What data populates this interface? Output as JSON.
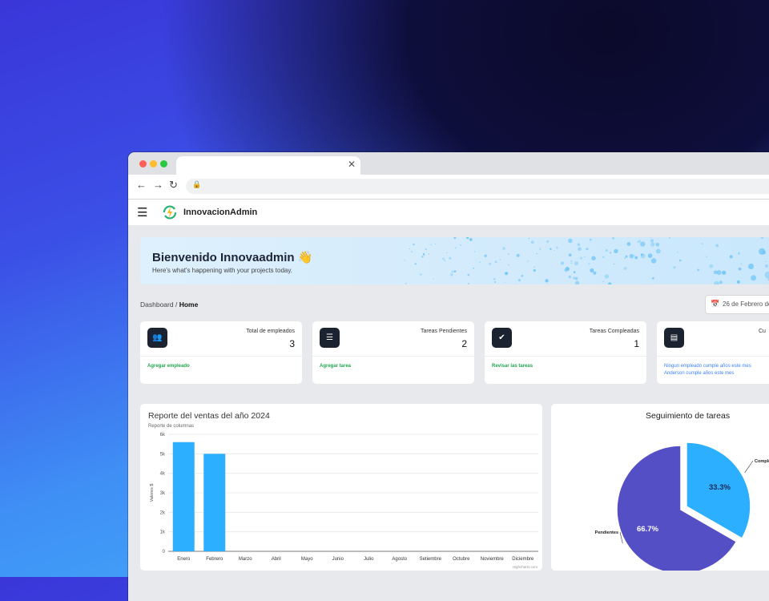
{
  "app": {
    "brand": "InnovacionAdmin"
  },
  "banner": {
    "title": "Bienvenido Innovaadmin 👋",
    "subtitle": "Here's what's happening with your projects today."
  },
  "breadcrumb": {
    "parent": "Dashboard",
    "separator": " / ",
    "current": "Home"
  },
  "date_filter": {
    "value": "26 de Febrero de"
  },
  "cards": [
    {
      "label": "Total de empleados",
      "value": "3",
      "link": "Agregar empleado",
      "icon": "users-icon"
    },
    {
      "label": "Tareas Pendientes",
      "value": "2",
      "link": "Agregar tarea",
      "icon": "list-icon"
    },
    {
      "label": "Tareas Compleadas",
      "value": "1",
      "link": "Revisar las tareas",
      "icon": "clipboard-check-icon"
    },
    {
      "label": "Cu",
      "value": "",
      "line1": "Ningun empleado cumple años este mes",
      "line2": "Anderson cumple años este mes",
      "icon": "cake-icon"
    }
  ],
  "sales_chart": {
    "title": "Reporte del ventas del año 2024",
    "subtitle": "Reporte de columnas",
    "credit": "Highcharts.com"
  },
  "tasks_chart": {
    "title": "Seguimiento de tareas"
  },
  "colors": {
    "bar": "#2caffe",
    "pie_completed": "#2caffe",
    "pie_pending": "#544fc5",
    "success": "#22a54e",
    "info": "#3b82f6"
  },
  "chart_data": [
    {
      "type": "bar",
      "title": "Reporte del ventas del año 2024",
      "subtitle": "Reporte de columnas",
      "ylabel": "Valores $",
      "xlabel": "",
      "categories": [
        "Enero",
        "Febrero",
        "Marzo",
        "Abril",
        "Mayo",
        "Junio",
        "Julio",
        "Agosto",
        "Setiembre",
        "Octubre",
        "Noviembre",
        "Diciembre"
      ],
      "values": [
        5600,
        5000,
        0,
        0,
        0,
        0,
        0,
        0,
        0,
        0,
        0,
        0
      ],
      "yticks": [
        "0",
        "1k",
        "2k",
        "3k",
        "4k",
        "5k",
        "6k"
      ],
      "ylim": [
        0,
        6000
      ],
      "grid": true
    },
    {
      "type": "pie",
      "title": "Seguimiento de tareas",
      "slices": [
        {
          "name": "Completadas",
          "display": "Comple",
          "value": 33.3,
          "label": "33.3%"
        },
        {
          "name": "Pendientes",
          "display": "Pendientes",
          "value": 66.7,
          "label": "66.7%"
        }
      ]
    }
  ]
}
